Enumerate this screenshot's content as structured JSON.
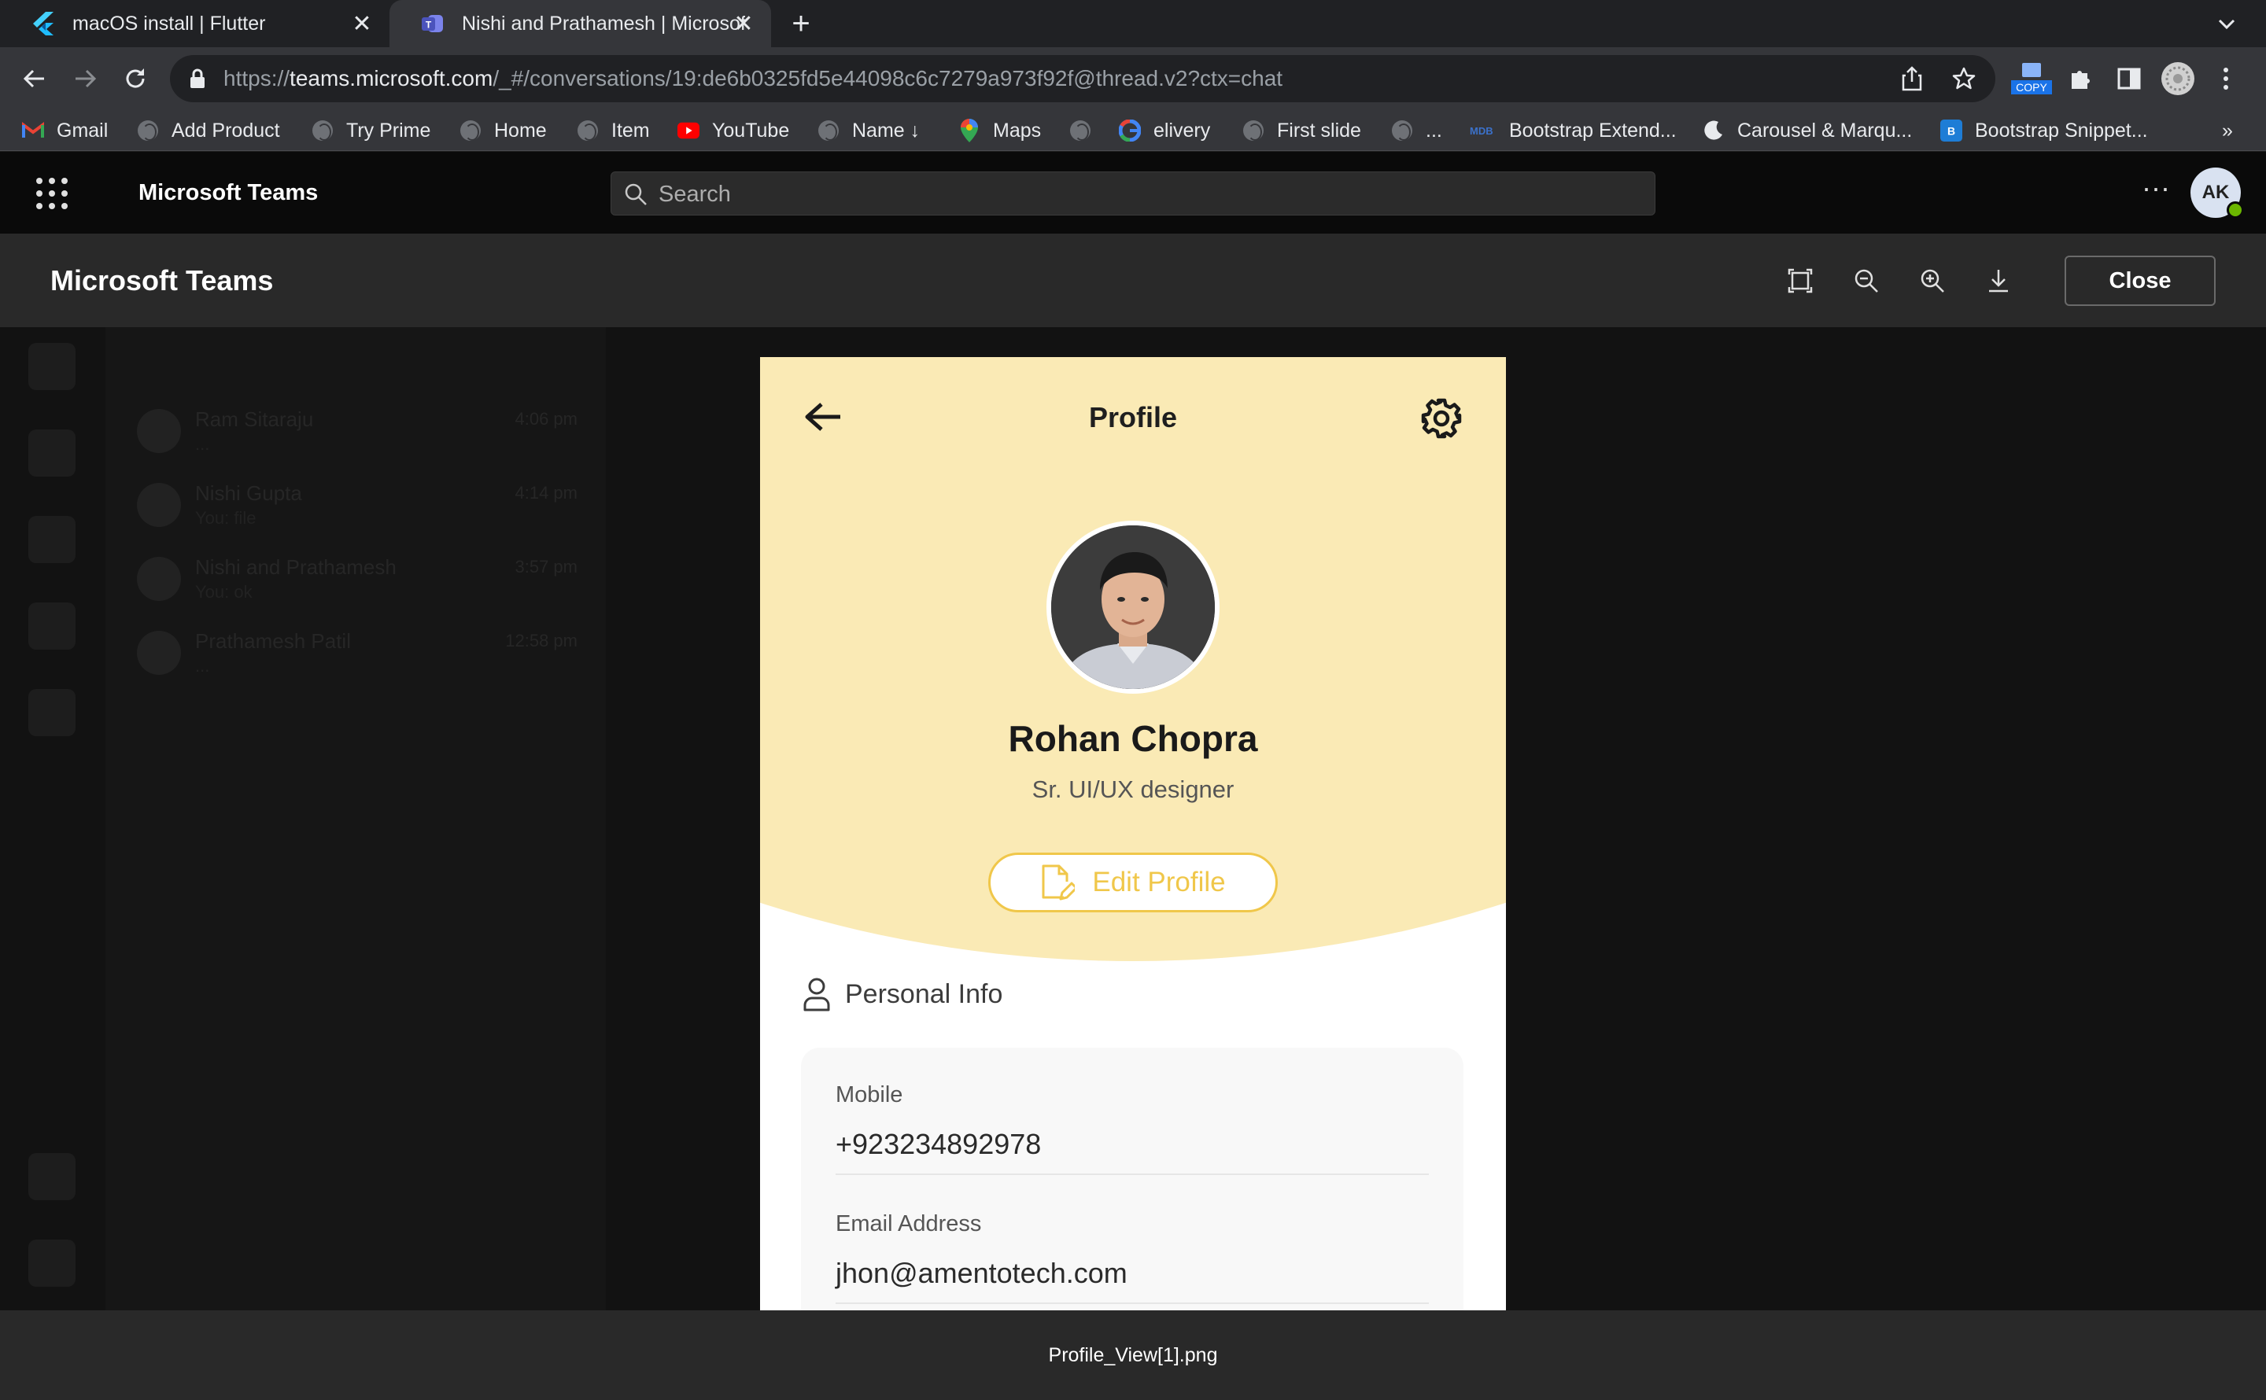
{
  "browser": {
    "tabs": [
      {
        "title": "macOS install | Flutter",
        "active": false,
        "icon": "flutter-icon"
      },
      {
        "title": "Nishi and Prathamesh | Microsoft Teams",
        "active": true,
        "icon": "teams-icon"
      }
    ],
    "url_prefix": "https://",
    "url_host": "teams.microsoft.com",
    "url_path": "/_#/conversations/19:de6b0325fd5e44098c6c7279a973f92f@thread.v2?ctx=chat",
    "extension_badge": "COPY",
    "bookmarks": [
      {
        "label": "Gmail",
        "icon": "gmail-icon"
      },
      {
        "label": "Add Product",
        "icon": "globe-icon"
      },
      {
        "label": "Try Prime",
        "icon": "globe-icon"
      },
      {
        "label": "Home",
        "icon": "globe-icon"
      },
      {
        "label": "Item",
        "icon": "globe-icon"
      },
      {
        "label": "YouTube",
        "icon": "youtube-icon"
      },
      {
        "label": "Name ↓",
        "icon": "globe-icon"
      },
      {
        "label": "Maps",
        "icon": "maps-icon"
      },
      {
        "label": "",
        "icon": "globe-icon"
      },
      {
        "label": "elivery",
        "icon": "google-icon"
      },
      {
        "label": "First slide",
        "icon": "globe-icon"
      },
      {
        "label": "...",
        "icon": "globe-icon"
      },
      {
        "label": "Bootstrap Extend...",
        "icon": "mdb-icon"
      },
      {
        "label": "Carousel & Marqu...",
        "icon": "moon-icon"
      },
      {
        "label": "Bootstrap Snippet...",
        "icon": "bootstrap-icon"
      }
    ],
    "bookmarks_overflow": "»"
  },
  "teams": {
    "app_name": "Microsoft Teams",
    "search_placeholder": "Search",
    "avatar_initials": "AK",
    "more_label": "···"
  },
  "viewer": {
    "title": "Microsoft Teams",
    "close_label": "Close",
    "file_name": "Profile_View[1].png"
  },
  "background_chats": [
    {
      "name": "Ram Sitaraju",
      "preview": "...",
      "time": "4:06 pm"
    },
    {
      "name": "Nishi Gupta",
      "preview": "You: file",
      "time": "4:14 pm"
    },
    {
      "name": "Nishi and Prathamesh",
      "preview": "You: ok",
      "time": "3:57 pm"
    },
    {
      "name": "Prathamesh Patil",
      "preview": "...",
      "time": "12:58 pm"
    }
  ],
  "profile": {
    "header_title": "Profile",
    "name": "Rohan Chopra",
    "role": "Sr. UI/UX designer",
    "edit_label": "Edit Profile",
    "section_title": "Personal Info",
    "fields": [
      {
        "label": "Mobile",
        "value": "+923234892978"
      },
      {
        "label": "Email Address",
        "value": "jhon@amentotech.com"
      }
    ]
  },
  "colors": {
    "accent_yellow": "#f0c74a",
    "hero_bg": "#faeab5",
    "presence_green": "#6bb700"
  }
}
